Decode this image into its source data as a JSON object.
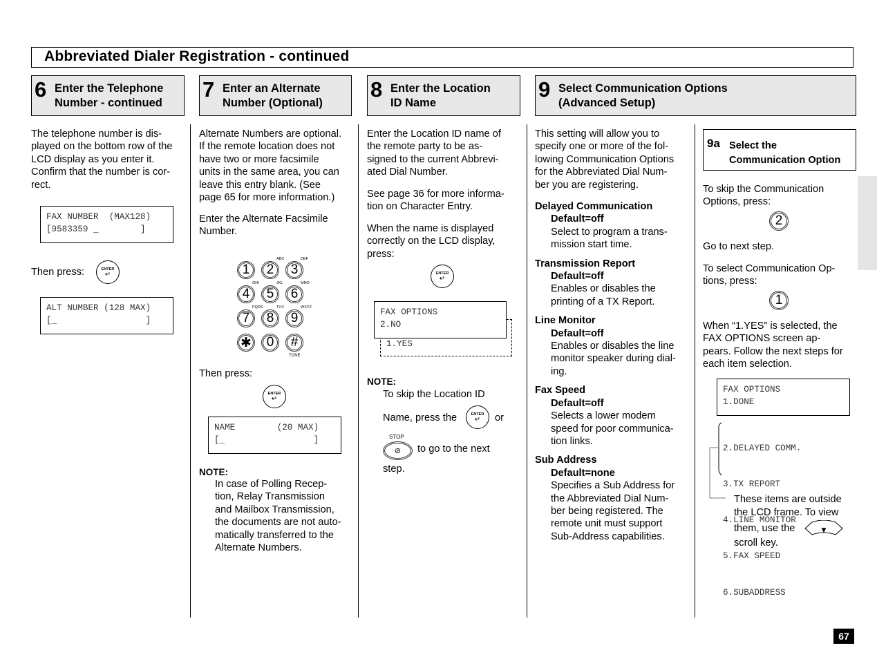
{
  "page": {
    "title": "Abbreviated Dialer Registration - continued",
    "page_number": "67"
  },
  "steps": [
    {
      "number": "6",
      "title_line1": "Enter the Telephone",
      "title_line2": "Number - continued"
    },
    {
      "number": "7",
      "title_line1": "Enter an Alternate",
      "title_line2": "Number (Optional)"
    },
    {
      "number": "8",
      "title_line1": "Enter the Location",
      "title_line2": "ID Name"
    },
    {
      "number": "9",
      "title_line1": "Select Communication Options",
      "title_line2": "(Advanced Setup)"
    }
  ],
  "col1": {
    "intro": [
      "The telephone number is dis-",
      "played on the bottom row of the",
      "LCD display as you enter it.",
      "Confirm that the number is cor-",
      "rect."
    ],
    "lcd1_line1": "FAX NUMBER  (MAX128)",
    "lcd1_line2": "[9583359 _        ]",
    "then_press": "Then press:",
    "lcd2_line1": "ALT NUMBER (128 MAX)",
    "lcd2_line2": "[_                 ]"
  },
  "col2": {
    "intro": [
      "Alternate Numbers are optional.",
      "If the remote location does not",
      "have two or more facsimile",
      "units in the same area, you can",
      "leave this entry blank. (See",
      "page 65 for more information.)"
    ],
    "enter_alt": [
      "Enter the Alternate Facsimile",
      "Number."
    ],
    "keypad": [
      {
        "key": "1",
        "sub": ""
      },
      {
        "key": "2",
        "sub": "ABC"
      },
      {
        "key": "3",
        "sub": "DEF"
      },
      {
        "key": "4",
        "sub": "GHI"
      },
      {
        "key": "5",
        "sub": "JKL"
      },
      {
        "key": "6",
        "sub": "MNO"
      },
      {
        "key": "7",
        "sub": "PQRS"
      },
      {
        "key": "8",
        "sub": "TUV"
      },
      {
        "key": "9",
        "sub": "WXYZ"
      },
      {
        "key": "✱",
        "sub": ""
      },
      {
        "key": "0",
        "sub": ""
      },
      {
        "key": "#",
        "sub": ""
      }
    ],
    "tone_label": "TONE",
    "then_press": "Then press:",
    "lcd_line1": "NAME        (20 MAX)",
    "lcd_line2": "[_                 ]",
    "note_heading": "NOTE:",
    "note": [
      "In case of Polling Recep-",
      "tion, Relay Transmission",
      "and Mailbox Transmission,",
      "the documents are not auto-",
      "matically transferred to the",
      "Alternate Numbers."
    ]
  },
  "col3": {
    "intro": [
      "Enter the Location ID name of",
      "the remote party to be as-",
      "signed to the current Abbrevi-",
      "ated Dial Number."
    ],
    "see_page": [
      "See page 36 for more informa-",
      "tion on  Character Entry."
    ],
    "when_name": [
      "When the name is displayed",
      "correctly on the LCD display,",
      "press:"
    ],
    "lcd_line1": "FAX OPTIONS",
    "lcd_line2": "2.NO",
    "lcd_hidden": "1.YES",
    "note_heading": "NOTE:",
    "note_line1": "To skip the Location ID",
    "note_line2a": "Name, press the",
    "note_line2b": "or",
    "stop_label": "STOP",
    "note_line3": "to go to the next",
    "note_line4": "step."
  },
  "col4": {
    "intro": [
      "This setting will allow you to",
      "specify one or more of the fol-",
      "lowing Communication Options",
      "for the Abbreviated Dial Num-",
      "ber you are registering."
    ],
    "options": [
      {
        "name": "Delayed  Communication",
        "default": "Default=off",
        "desc": [
          "Select to program a trans-",
          "mission  start  time."
        ]
      },
      {
        "name": "Transmission  Report",
        "default": "Default=off",
        "desc": [
          "Enables or disables the",
          "printing of a TX Report."
        ]
      },
      {
        "name": "Line  Monitor",
        "default": "Default=off",
        "desc": [
          "Enables or disables the line",
          "monitor speaker during dial-",
          "ing."
        ]
      },
      {
        "name": "Fax Speed",
        "default": "Default=off",
        "desc": [
          "Selects a lower modem",
          "speed for poor communica-",
          "tion  links."
        ]
      },
      {
        "name": "Sub  Address",
        "default": "Default=none",
        "desc": [
          "Specifies a Sub Address for",
          "the Abbreviated Dial Num-",
          "ber being registered. The",
          "remote unit must support",
          "Sub-Address  capabilities."
        ]
      }
    ]
  },
  "col5": {
    "sub_number": "9a",
    "sub_title_line1": "Select the",
    "sub_title_line2": "Communication Option",
    "skip_text": [
      "To skip the Communication",
      "Options,  press:"
    ],
    "skip_key": "2",
    "go_next": "Go to next step.",
    "select_text": [
      "To select Communication Op-",
      "tions,  press:"
    ],
    "select_key": "1",
    "when_yes": [
      "When “1.YES” is selected, the",
      "FAX OPTIONS screen ap-",
      "pears. Follow the next steps for",
      "each  item  selection."
    ],
    "lcd_line1": "FAX OPTIONS",
    "lcd_line2": "1.DONE",
    "hidden_items": [
      "2.DELAYED COMM.",
      "3.TX REPORT",
      "4.LINE MONITOR",
      "5.FAX SPEED",
      "6.SUBADDRESS"
    ],
    "outside_text1": "These items are outside",
    "outside_text2": "the LCD frame. To view",
    "outside_text3": "them, use the",
    "outside_text4": "scroll  key."
  },
  "keys": {
    "enter_label": "ENTER",
    "enter_arrow": "↵",
    "scroll_arrow": "▼",
    "stop_symbol": "⊘"
  }
}
